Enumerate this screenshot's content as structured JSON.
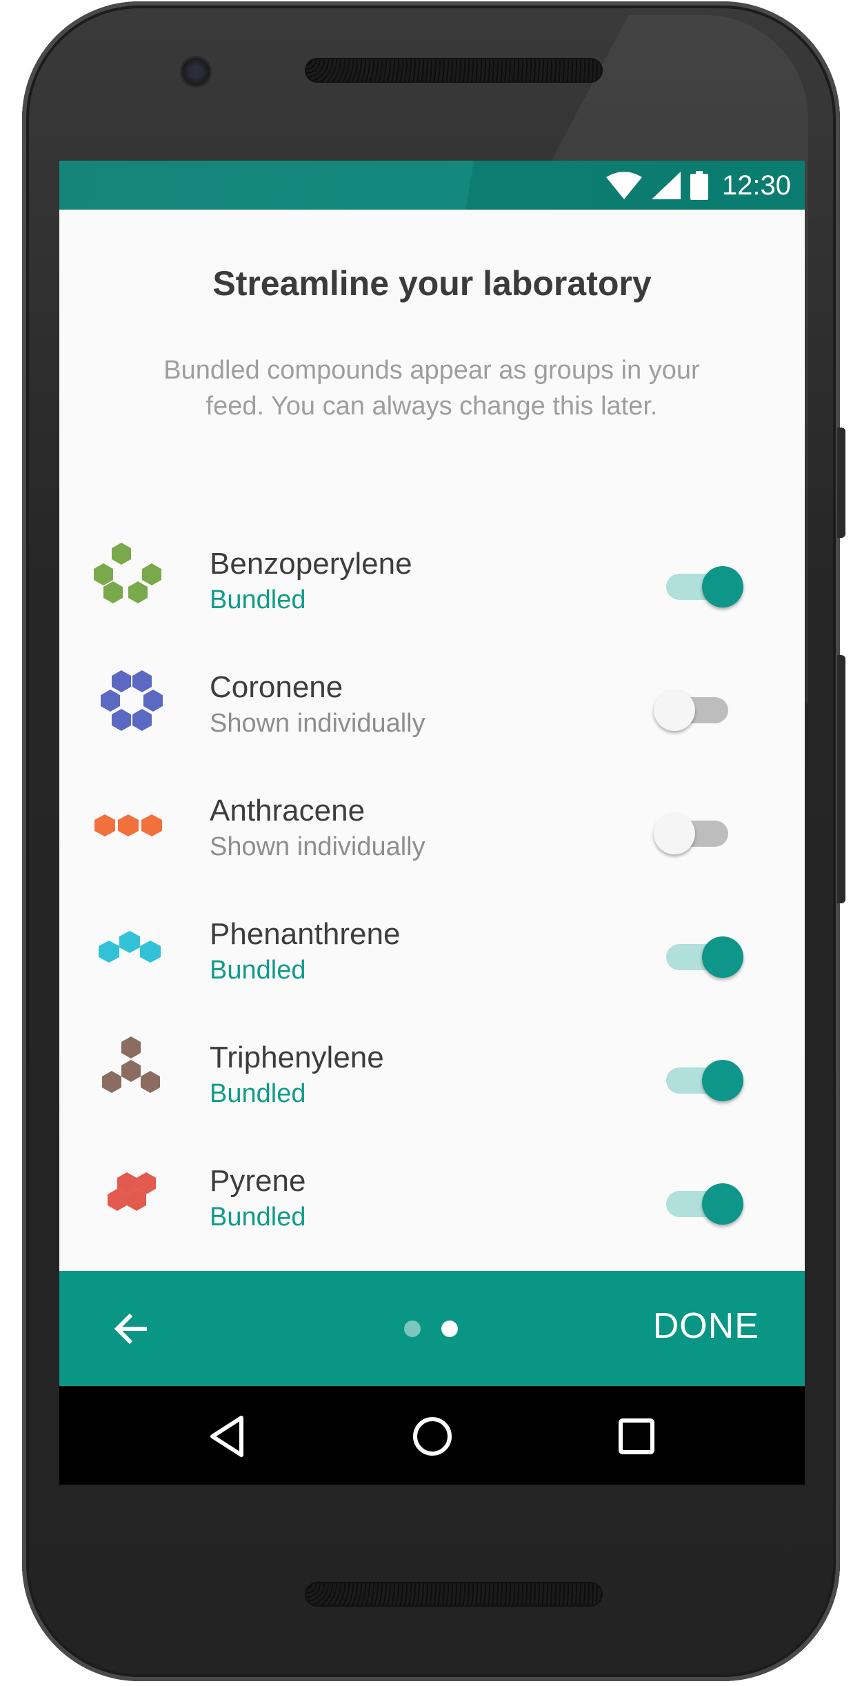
{
  "status_bar": {
    "time": "12:30",
    "icons": [
      "wifi-icon",
      "cell-signal-icon",
      "battery-icon"
    ]
  },
  "header": {
    "title": "Streamline your laboratory",
    "subtitle": "Bundled compounds appear as groups in your feed. You can always change this later."
  },
  "compounds": [
    {
      "name": "Benzoperylene",
      "state": "Bundled",
      "enabled": true,
      "color": "#79a94a",
      "icon": "benzoperylene-icon"
    },
    {
      "name": "Coronene",
      "state": "Shown individually",
      "enabled": false,
      "color": "#5b69c3",
      "icon": "coronene-icon"
    },
    {
      "name": "Anthracene",
      "state": "Shown individually",
      "enabled": false,
      "color": "#f2703c",
      "icon": "anthracene-icon"
    },
    {
      "name": "Phenanthrene",
      "state": "Bundled",
      "enabled": true,
      "color": "#32c2d8",
      "icon": "phenanthrene-icon"
    },
    {
      "name": "Triphenylene",
      "state": "Bundled",
      "enabled": true,
      "color": "#8a6c60",
      "icon": "triphenylene-icon"
    },
    {
      "name": "Pyrene",
      "state": "Bundled",
      "enabled": true,
      "color": "#e35a4f",
      "icon": "pyrene-icon"
    }
  ],
  "footer": {
    "back_icon": "arrow-left-icon",
    "page_count": 2,
    "current_page": 2,
    "done_label": "DONE"
  },
  "navigation_bar": {
    "icons": [
      "nav-back-icon",
      "nav-home-icon",
      "nav-recents-icon"
    ]
  },
  "colors": {
    "accent": "#099685",
    "status_bar": "#12897c",
    "switch_on": "#0f968a"
  }
}
